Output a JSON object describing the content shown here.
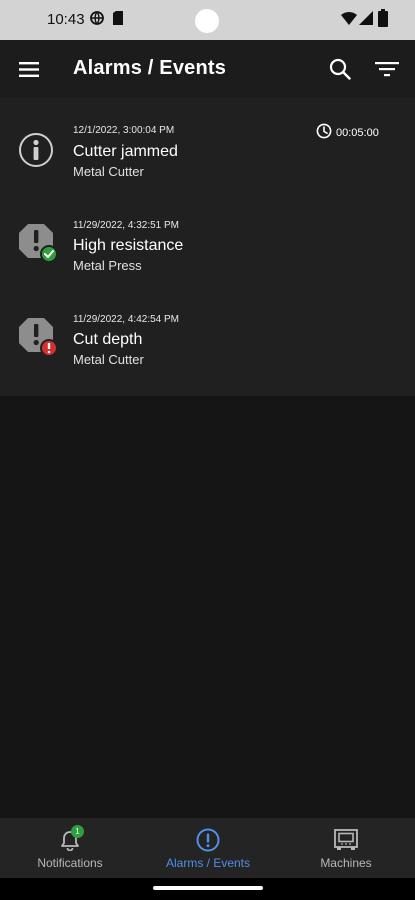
{
  "status_bar": {
    "time": "10:43"
  },
  "app_bar": {
    "title": "Alarms / Events",
    "menu_icon": "hamburger-menu-icon",
    "search_icon": "search-icon",
    "filter_icon": "filter-icon"
  },
  "alarms": [
    {
      "timestamp": "12/1/2022, 3:00:04 PM",
      "name": "Cutter jammed",
      "machine": "Metal Cutter",
      "duration": "00:05:00",
      "icon": "info-icon"
    },
    {
      "timestamp": "11/29/2022, 4:32:51 PM",
      "name": "High resistance",
      "machine": "Metal Press",
      "icon": "alarm-resolved-icon",
      "status_color": "#2e9e3e"
    },
    {
      "timestamp": "11/29/2022, 4:42:54 PM",
      "name": "Cut depth",
      "machine": "Metal Cutter",
      "icon": "alarm-active-icon",
      "status_color": "#d32f2f"
    }
  ],
  "bottom_nav": {
    "items": [
      {
        "label": "Notifications",
        "badge": "1",
        "icon": "bell-icon"
      },
      {
        "label": "Alarms / Events",
        "icon": "alert-circle-icon",
        "active": true
      },
      {
        "label": "Machines",
        "icon": "machine-icon"
      }
    ]
  },
  "colors": {
    "accent": "#4f8fe6",
    "background": "#151515",
    "list_background": "#202020",
    "app_bar": "#1c1c1c"
  }
}
